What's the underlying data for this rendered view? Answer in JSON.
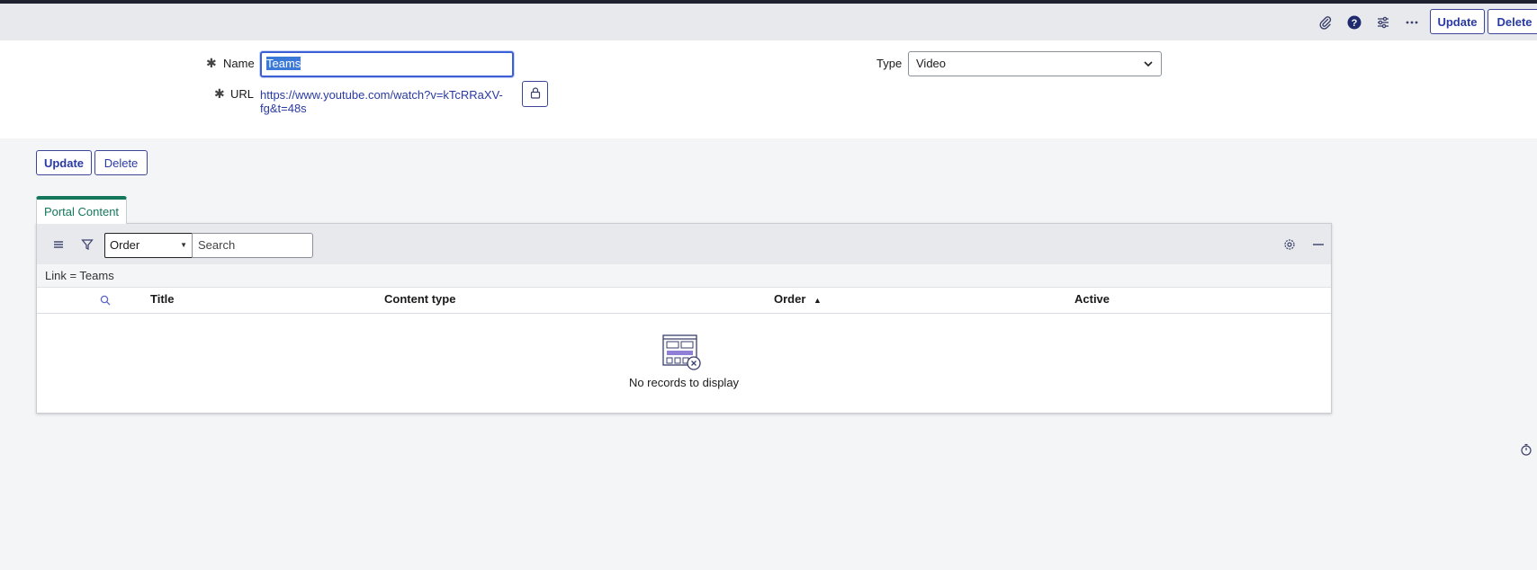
{
  "header": {
    "icons": [
      "paperclip-icon",
      "help-icon",
      "settings-sliders-icon",
      "more-icon"
    ],
    "update_label": "Update",
    "delete_label": "Delete"
  },
  "form": {
    "name_label": "Name",
    "name_value": "Teams",
    "url_label": "URL",
    "url_value": "https://www.youtube.com/watch?v=kTcRRaXV-fg&t=48s",
    "type_label": "Type",
    "type_value": "Video"
  },
  "actions": {
    "update_label": "Update",
    "delete_label": "Delete"
  },
  "related_list": {
    "tab_label": "Portal Content",
    "filter_field": "Order",
    "search_placeholder": "Search",
    "breadcrumb": "Link = Teams",
    "columns": [
      "Title",
      "Content type",
      "Order",
      "Active"
    ],
    "sort_column": "Order",
    "sort_direction": "ascending",
    "empty_message": "No records to display"
  },
  "colors": {
    "accent": "#293aa3",
    "tab_green": "#14775b",
    "header_bg": "#e8e9ec"
  }
}
